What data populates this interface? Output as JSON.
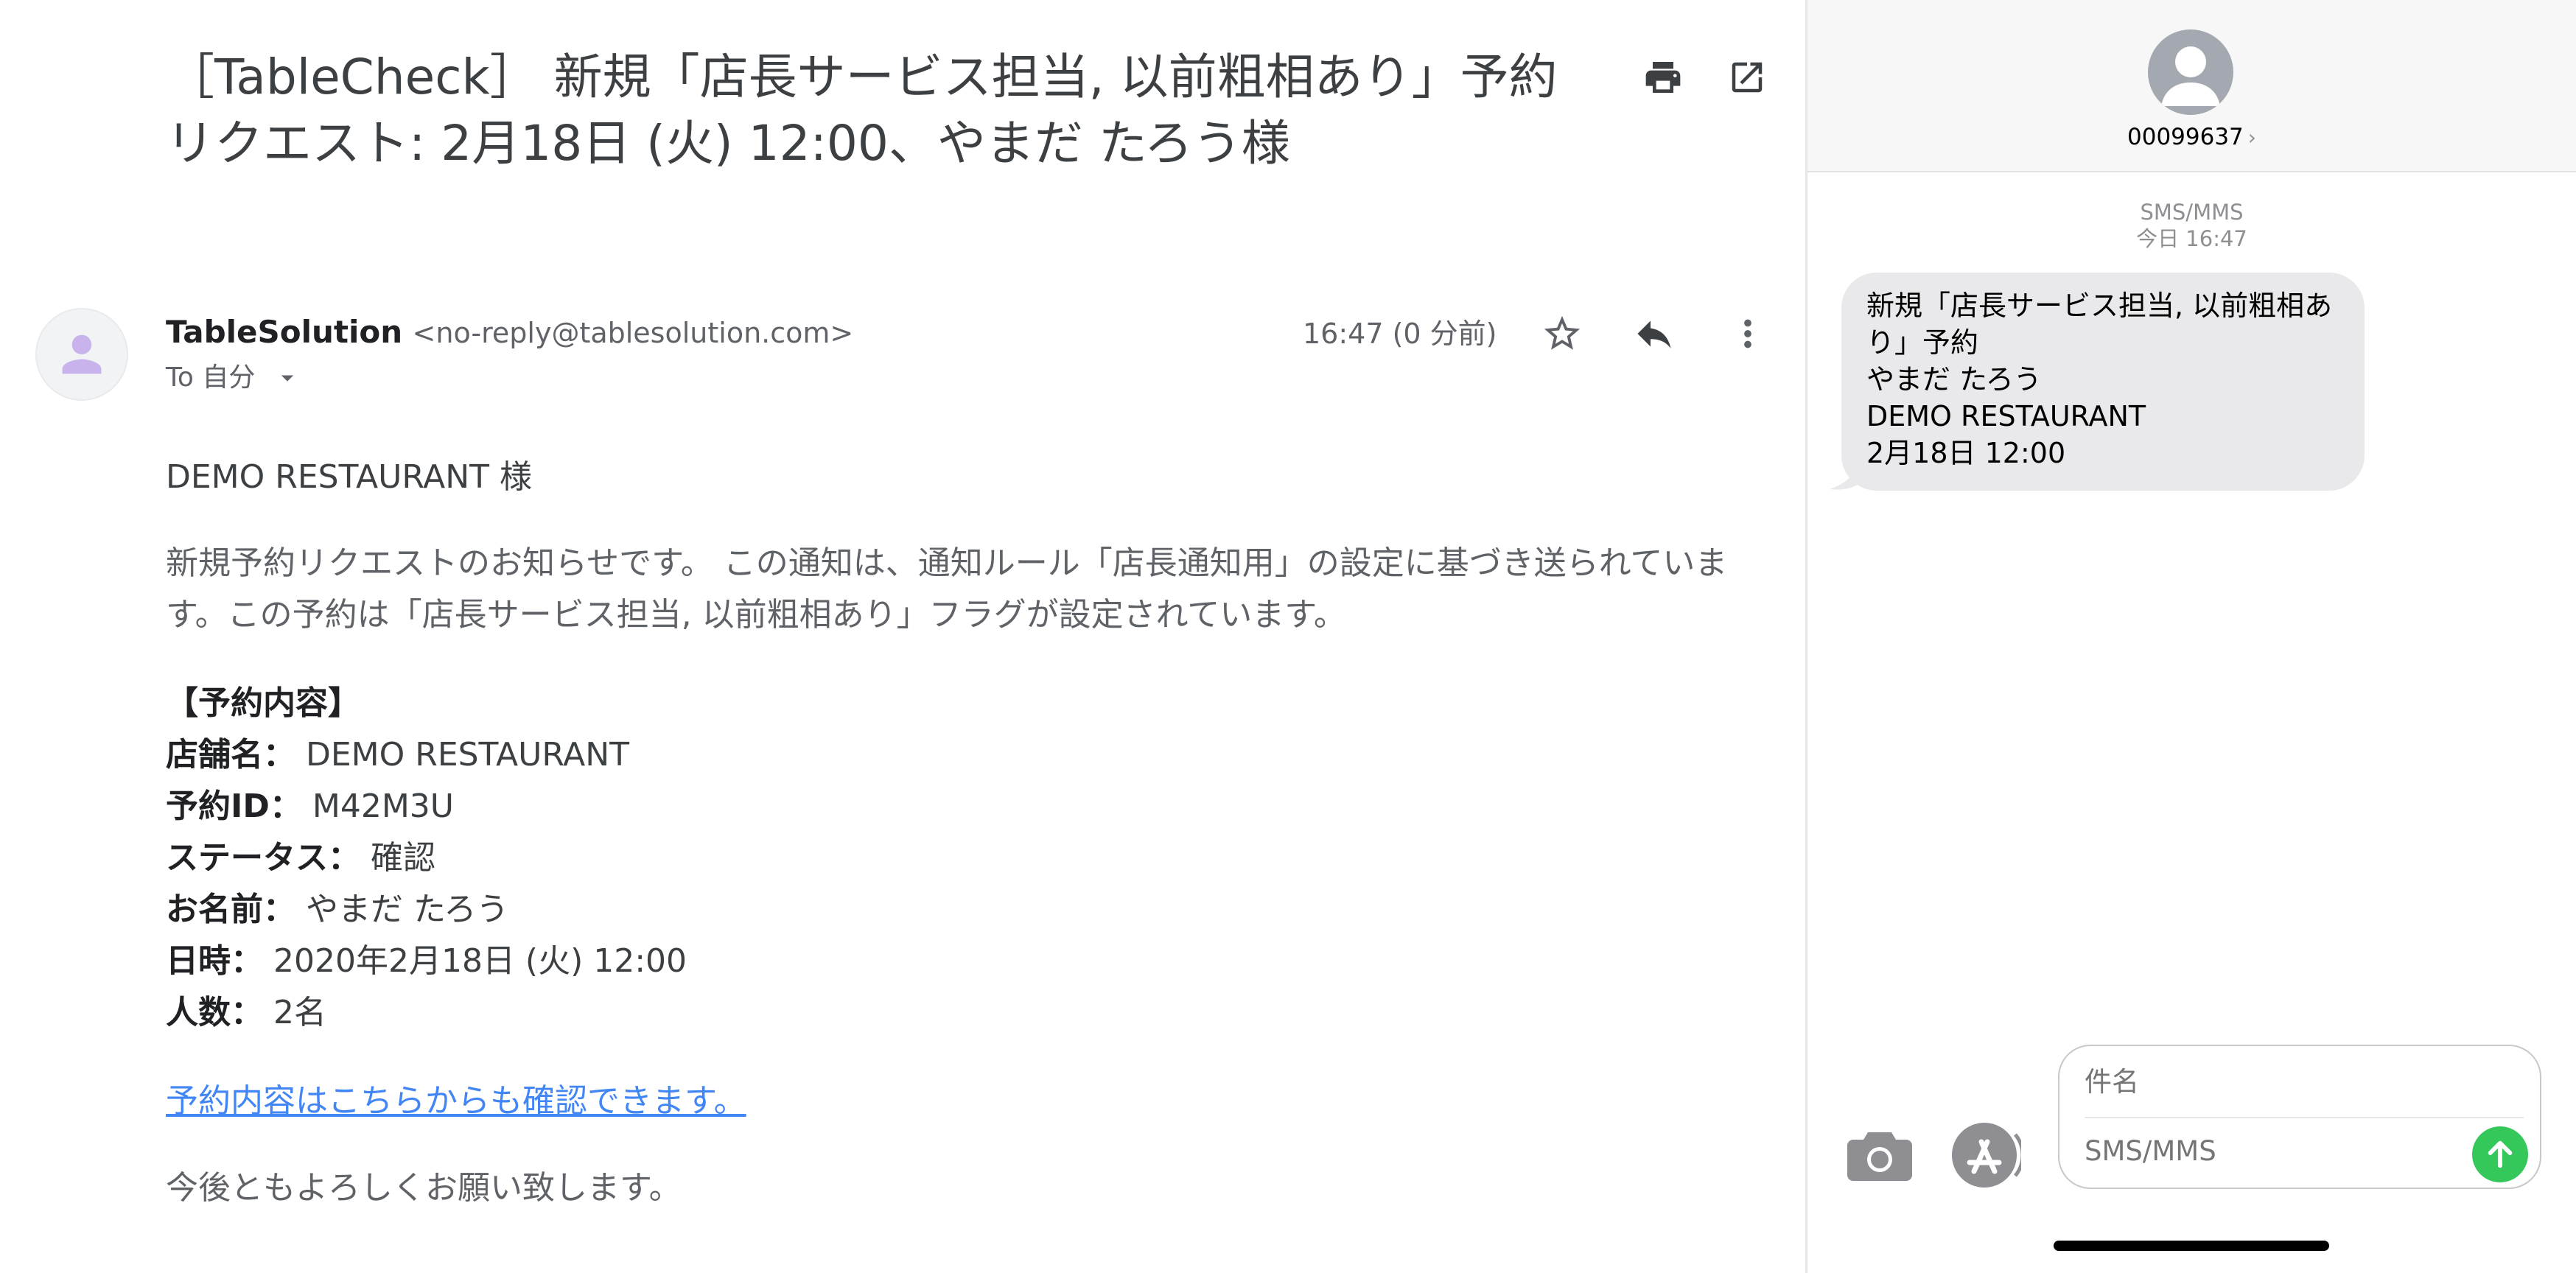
{
  "email": {
    "subject": "［TableCheck］ 新規「店長サービス担当, 以前粗相あり」予約リクエスト: 2月18日 (火) 12:00、やまだ たろう様",
    "sender": {
      "name": "TableSolution",
      "email": "<no-reply@tablesolution.com>"
    },
    "to_label": "To 自分",
    "timestamp": "16:47 (0 分前)",
    "greeting": "DEMO RESTAURANT 様",
    "intro": "新規予約リクエストのお知らせです。 この通知は、通知ルール「店長通知用」の設定に基づき送られています。この予約は「店長サービス担当, 以前粗相あり」フラグが設定されています。",
    "details": {
      "heading": "【予約内容】",
      "rows": [
        {
          "label": "店舗名：",
          "value": " DEMO RESTAURANT"
        },
        {
          "label": "予約ID：",
          "value": " M42M3U"
        },
        {
          "label": "ステータス：",
          "value": " 確認"
        },
        {
          "label": "お名前：",
          "value": " やまだ たろう"
        },
        {
          "label": "日時：",
          "value": " 2020年2月18日 (火) 12:00"
        },
        {
          "label": "人数：",
          "value": " 2名"
        }
      ]
    },
    "confirm_link": "予約内容はこちらからも確認できます。",
    "closing": "今後ともよろしくお願い致します。",
    "icons": {
      "print": "printer-icon",
      "open": "open-in-new-window-icon",
      "star": "star-icon",
      "reply": "reply-icon",
      "more": "more-vert-icon",
      "avatar": "person-icon",
      "to_caret": "caret-down-icon"
    }
  },
  "sms": {
    "contact": "00099637",
    "chevron": "›",
    "service": "SMS/MMS",
    "time": "今日 16:47",
    "message_lines": [
      "新規「店長サービス担当, 以前粗相あ",
      "り」予約",
      "やまだ たろう",
      "DEMO RESTAURANT",
      "2月18日 12:00"
    ],
    "compose": {
      "subject_placeholder": "件名",
      "body_placeholder": "SMS/MMS"
    },
    "colors": {
      "bubble": "#e9e9eb",
      "send": "#34c759",
      "link": "#4285f4"
    }
  }
}
